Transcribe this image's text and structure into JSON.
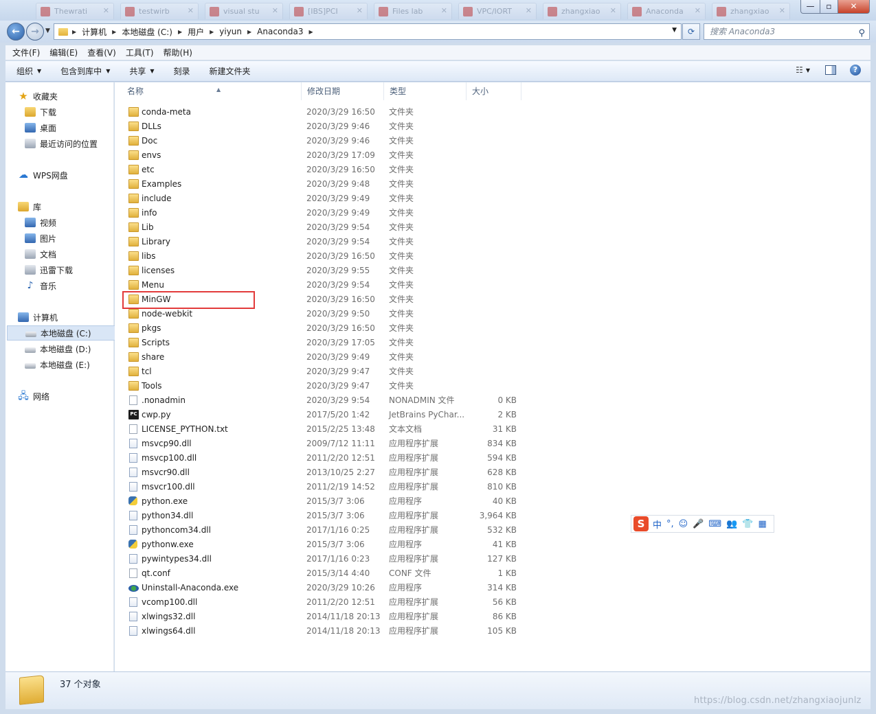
{
  "window": {
    "ghost_tabs": [
      "Thewrati",
      "testwirb",
      "visual stu",
      "[IBS]PCI",
      "Files lab",
      "VPC/IORT",
      "zhangxiao",
      "Anaconda",
      "zhangxiao"
    ],
    "minimize": "—",
    "maximize": "▫",
    "close": "✕"
  },
  "address": {
    "breadcrumb": [
      "计算机",
      "本地磁盘 (C:)",
      "用户",
      "yiyun",
      "Anaconda3"
    ],
    "separator": "▶",
    "search_placeholder": "搜索 Anaconda3"
  },
  "menubar": [
    "文件(F)",
    "编辑(E)",
    "查看(V)",
    "工具(T)",
    "帮助(H)"
  ],
  "commandbar": [
    {
      "label": "组织",
      "dropdown": true
    },
    {
      "label": "包含到库中",
      "dropdown": true
    },
    {
      "label": "共享",
      "dropdown": true
    },
    {
      "label": "刻录",
      "dropdown": false
    },
    {
      "label": "新建文件夹",
      "dropdown": false
    }
  ],
  "navpane": {
    "favorites": "收藏夹",
    "downloads": "下载",
    "desktop": "桌面",
    "recent": "最近访问的位置",
    "wps": "WPS网盘",
    "libraries": "库",
    "videos": "视频",
    "pictures": "图片",
    "documents": "文档",
    "xunlei": "迅雷下载",
    "music": "音乐",
    "computer": "计算机",
    "drive_c": "本地磁盘 (C:)",
    "drive_d": "本地磁盘 (D:)",
    "drive_e": "本地磁盘 (E:)",
    "network": "网络"
  },
  "columns": {
    "name": "名称",
    "date": "修改日期",
    "type": "类型",
    "size": "大小"
  },
  "files": [
    {
      "name": "conda-meta",
      "date": "2020/3/29 16:50",
      "type": "文件夹",
      "size": "",
      "icon": "folder"
    },
    {
      "name": "DLLs",
      "date": "2020/3/29 9:46",
      "type": "文件夹",
      "size": "",
      "icon": "folder"
    },
    {
      "name": "Doc",
      "date": "2020/3/29 9:46",
      "type": "文件夹",
      "size": "",
      "icon": "folder"
    },
    {
      "name": "envs",
      "date": "2020/3/29 17:09",
      "type": "文件夹",
      "size": "",
      "icon": "folder"
    },
    {
      "name": "etc",
      "date": "2020/3/29 16:50",
      "type": "文件夹",
      "size": "",
      "icon": "folder"
    },
    {
      "name": "Examples",
      "date": "2020/3/29 9:48",
      "type": "文件夹",
      "size": "",
      "icon": "folder"
    },
    {
      "name": "include",
      "date": "2020/3/29 9:49",
      "type": "文件夹",
      "size": "",
      "icon": "folder"
    },
    {
      "name": "info",
      "date": "2020/3/29 9:49",
      "type": "文件夹",
      "size": "",
      "icon": "folder"
    },
    {
      "name": "Lib",
      "date": "2020/3/29 9:54",
      "type": "文件夹",
      "size": "",
      "icon": "folder"
    },
    {
      "name": "Library",
      "date": "2020/3/29 9:54",
      "type": "文件夹",
      "size": "",
      "icon": "folder"
    },
    {
      "name": "libs",
      "date": "2020/3/29 16:50",
      "type": "文件夹",
      "size": "",
      "icon": "folder"
    },
    {
      "name": "licenses",
      "date": "2020/3/29 9:55",
      "type": "文件夹",
      "size": "",
      "icon": "folder"
    },
    {
      "name": "Menu",
      "date": "2020/3/29 9:54",
      "type": "文件夹",
      "size": "",
      "icon": "folder"
    },
    {
      "name": "MinGW",
      "date": "2020/3/29 16:50",
      "type": "文件夹",
      "size": "",
      "icon": "folder"
    },
    {
      "name": "node-webkit",
      "date": "2020/3/29 9:50",
      "type": "文件夹",
      "size": "",
      "icon": "folder"
    },
    {
      "name": "pkgs",
      "date": "2020/3/29 16:50",
      "type": "文件夹",
      "size": "",
      "icon": "folder"
    },
    {
      "name": "Scripts",
      "date": "2020/3/29 17:05",
      "type": "文件夹",
      "size": "",
      "icon": "folder"
    },
    {
      "name": "share",
      "date": "2020/3/29 9:49",
      "type": "文件夹",
      "size": "",
      "icon": "folder"
    },
    {
      "name": "tcl",
      "date": "2020/3/29 9:47",
      "type": "文件夹",
      "size": "",
      "icon": "folder"
    },
    {
      "name": "Tools",
      "date": "2020/3/29 9:47",
      "type": "文件夹",
      "size": "",
      "icon": "folder"
    },
    {
      "name": ".nonadmin",
      "date": "2020/3/29 9:54",
      "type": "NONADMIN 文件",
      "size": "0 KB",
      "icon": "file"
    },
    {
      "name": "cwp.py",
      "date": "2017/5/20 1:42",
      "type": "JetBrains PyChar...",
      "size": "2 KB",
      "icon": "pyc"
    },
    {
      "name": "LICENSE_PYTHON.txt",
      "date": "2015/2/25 13:48",
      "type": "文本文档",
      "size": "31 KB",
      "icon": "file"
    },
    {
      "name": "msvcp90.dll",
      "date": "2009/7/12 11:11",
      "type": "应用程序扩展",
      "size": "834 KB",
      "icon": "dll"
    },
    {
      "name": "msvcp100.dll",
      "date": "2011/2/20 12:51",
      "type": "应用程序扩展",
      "size": "594 KB",
      "icon": "dll"
    },
    {
      "name": "msvcr90.dll",
      "date": "2013/10/25 2:27",
      "type": "应用程序扩展",
      "size": "628 KB",
      "icon": "dll"
    },
    {
      "name": "msvcr100.dll",
      "date": "2011/2/19 14:52",
      "type": "应用程序扩展",
      "size": "810 KB",
      "icon": "dll"
    },
    {
      "name": "python.exe",
      "date": "2015/3/7 3:06",
      "type": "应用程序",
      "size": "40 KB",
      "icon": "python"
    },
    {
      "name": "python34.dll",
      "date": "2015/3/7 3:06",
      "type": "应用程序扩展",
      "size": "3,964 KB",
      "icon": "dll"
    },
    {
      "name": "pythoncom34.dll",
      "date": "2017/1/16 0:25",
      "type": "应用程序扩展",
      "size": "532 KB",
      "icon": "dll"
    },
    {
      "name": "pythonw.exe",
      "date": "2015/3/7 3:06",
      "type": "应用程序",
      "size": "41 KB",
      "icon": "python"
    },
    {
      "name": "pywintypes34.dll",
      "date": "2017/1/16 0:23",
      "type": "应用程序扩展",
      "size": "127 KB",
      "icon": "dll"
    },
    {
      "name": "qt.conf",
      "date": "2015/3/14 4:40",
      "type": "CONF 文件",
      "size": "1 KB",
      "icon": "file"
    },
    {
      "name": "Uninstall-Anaconda.exe",
      "date": "2020/3/29 10:26",
      "type": "应用程序",
      "size": "314 KB",
      "icon": "uninstall"
    },
    {
      "name": "vcomp100.dll",
      "date": "2011/2/20 12:51",
      "type": "应用程序扩展",
      "size": "56 KB",
      "icon": "dll"
    },
    {
      "name": "xlwings32.dll",
      "date": "2014/11/18 20:13",
      "type": "应用程序扩展",
      "size": "86 KB",
      "icon": "dll"
    },
    {
      "name": "xlwings64.dll",
      "date": "2014/11/18 20:13",
      "type": "应用程序扩展",
      "size": "105 KB",
      "icon": "dll"
    }
  ],
  "highlighted_file": "MinGW",
  "ime": {
    "logo": "S",
    "mode": "中",
    "punct": "°,",
    "emoji": "☺",
    "mic": "🎤",
    "keyboard": "⌨",
    "user": "👥",
    "skin": "👕",
    "tools": "▦"
  },
  "status": {
    "count": "37 个对象"
  },
  "watermark": "https://blog.csdn.net/zhangxiaojunlz",
  "colors": {
    "highlight": "#e23a3a",
    "folder": "#e1b13d",
    "selection": "#d9e6f6"
  }
}
